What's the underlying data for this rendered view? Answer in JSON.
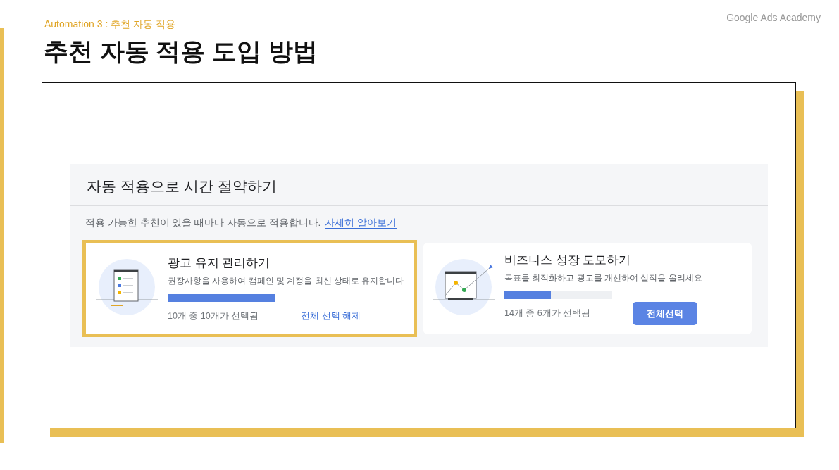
{
  "slide": {
    "kicker": "Automation 3 : 추천 자동 적용",
    "title": "추천 자동 적용 도입 방법",
    "brand": "Google Ads Academy"
  },
  "panel": {
    "title": "자동 적용으로 시간 절약하기",
    "description": "적용 가능한 추천이 있을 때마다 자동으로 적용합니다.",
    "link": "자세히 알아보기",
    "cards": [
      {
        "kind": "checklist",
        "highlighted": true,
        "title": "광고 유지 관리하기",
        "subtitle": "권장사항을 사용하여 캠페인 및 계정을 최신 상태로 유지합니다",
        "level": 1.0,
        "count": "10개 중 10개가 선택됨",
        "action": {
          "kind": "link",
          "label": "전체 선택 해제"
        }
      },
      {
        "kind": "growth",
        "highlighted": false,
        "title": "비즈니스 성장 도모하기",
        "subtitle": "목표를 최적화하고 광고를 개선하여 실적을 올리세요",
        "level": 0.43,
        "count": "14개 중 6개가 선택됨",
        "action": {
          "kind": "button",
          "label": "전체선택"
        }
      }
    ]
  }
}
